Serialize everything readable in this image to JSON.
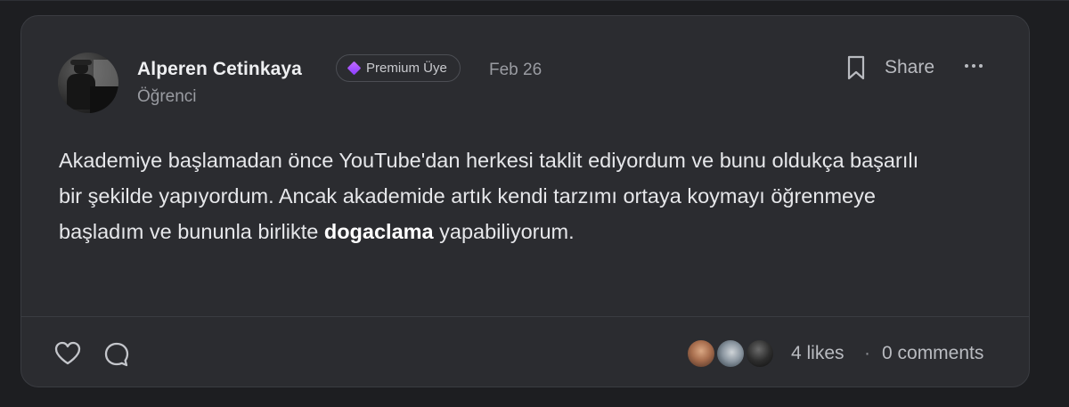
{
  "post": {
    "author": {
      "name": "Alperen Cetinkaya",
      "role": "Öğrenci",
      "avatar_icon": "author-avatar"
    },
    "badge": {
      "label": "Premium Üye",
      "icon": "diamond-icon",
      "color": "#a855f7"
    },
    "date": "Feb 26",
    "actions": {
      "bookmark_icon": "bookmark-icon",
      "share_label": "Share",
      "more_icon": "more-horizontal-icon"
    },
    "body": {
      "text_before_bold": "Akademiye başlamadan önce YouTube'dan herkesi taklit ediyordum ve bunu oldukça başarılı bir şekilde yapıyordum. Ancak akademide artık kendi tarzımı ortaya koymayı öğrenmeye başladım ve bununla birlikte ",
      "bold": "dogaclama",
      "text_after_bold": " yapabiliyorum."
    },
    "footer": {
      "like_icon": "heart-icon",
      "comment_icon": "comment-icon",
      "likes": "4 likes",
      "separator": "·",
      "comments": "0 comments"
    }
  },
  "colors": {
    "background": "#1d1e21",
    "card": "#2b2c30",
    "border": "#3a3c41",
    "text_primary": "#e6e7ea",
    "text_secondary": "#9a9ca2"
  }
}
